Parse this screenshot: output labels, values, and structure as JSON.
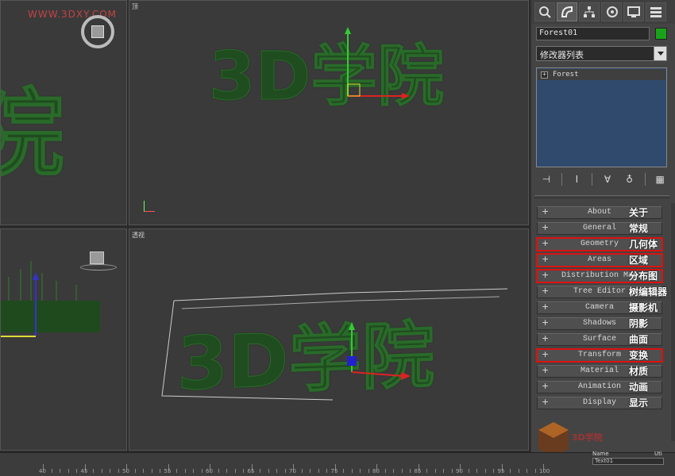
{
  "watermark": {
    "text": "WWW.3DXY.COM"
  },
  "viewports": {
    "top": {
      "label": "顶",
      "text": "3D学院"
    },
    "left": {
      "text": "院"
    },
    "perspective": {
      "label": "透视",
      "text": "3D学院"
    }
  },
  "panel": {
    "tabs": [
      "create-icon",
      "modify-icon",
      "hierarchy-icon",
      "motion-icon",
      "display-icon",
      "utilities-icon"
    ],
    "object_name": "Forest01",
    "object_color": "#1aa31a",
    "modifier_list": "修改器列表",
    "stack_items": [
      "Forest"
    ],
    "rollouts": [
      {
        "en": "About",
        "cn": "关于",
        "highlight": false
      },
      {
        "en": "General",
        "cn": "常规",
        "highlight": false
      },
      {
        "en": "Geometry",
        "cn": "几何体",
        "highlight": true
      },
      {
        "en": "Areas",
        "cn": "区域",
        "highlight": true
      },
      {
        "en": "Distribution Map",
        "cn": "分布图",
        "highlight": true
      },
      {
        "en": "Tree Editor",
        "cn": "树编辑器",
        "highlight": false
      },
      {
        "en": "Camera",
        "cn": "摄影机",
        "highlight": false
      },
      {
        "en": "Shadows",
        "cn": "阴影",
        "highlight": false
      },
      {
        "en": "Surface",
        "cn": "曲面",
        "highlight": false
      },
      {
        "en": "Transform",
        "cn": "变换",
        "highlight": true
      },
      {
        "en": "Material",
        "cn": "材质",
        "highlight": false
      },
      {
        "en": "Animation",
        "cn": "动画",
        "highlight": false
      },
      {
        "en": "Display",
        "cn": "显示",
        "highlight": false
      }
    ]
  },
  "timeline": {
    "labels": [
      "40",
      "45",
      "50",
      "55",
      "60",
      "65",
      "70",
      "75",
      "80",
      "85",
      "90",
      "95",
      "100"
    ]
  },
  "status": {
    "name_label": "Name",
    "uti_label": "Uti",
    "name_value": "Text01"
  },
  "logo": {
    "text": "3D学院"
  },
  "colors": {
    "highlight": "#d11111",
    "stack_bg": "#2f4a6c",
    "foliage": "#1f4d1f"
  }
}
